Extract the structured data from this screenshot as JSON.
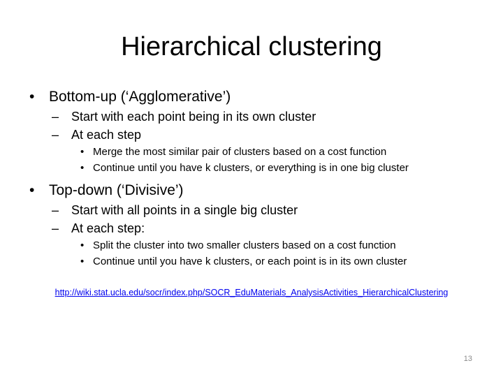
{
  "slide": {
    "title": "Hierarchical clustering",
    "bullets": [
      {
        "marker": "•",
        "text": "Bottom-up (‘Agglomerative’)",
        "sub": [
          {
            "marker": "–",
            "text": "Start with each point being in its own cluster"
          },
          {
            "marker": "–",
            "text": "At each step"
          }
        ],
        "subsub": [
          {
            "marker": "•",
            "text": "Merge the most similar pair of clusters based on a cost function"
          },
          {
            "marker": "•",
            "text": "Continue until  you have k clusters, or everything is in one big cluster"
          }
        ]
      },
      {
        "marker": "•",
        "text": "Top-down (‘Divisive’)",
        "sub": [
          {
            "marker": "–",
            "text": "Start with all points in a single big cluster"
          },
          {
            "marker": "–",
            "text": "At each step:"
          }
        ],
        "subsub": [
          {
            "marker": "•",
            "text": "Split the cluster into two smaller clusters based on a cost function"
          },
          {
            "marker": "•",
            "text": "Continue until you have k clusters, or each point is in its own cluster"
          }
        ]
      }
    ],
    "link": "http://wiki.stat.ucla.edu/socr/index.php/SOCR_EduMaterials_AnalysisActivities_HierarchicalClustering",
    "page_number": "13"
  }
}
